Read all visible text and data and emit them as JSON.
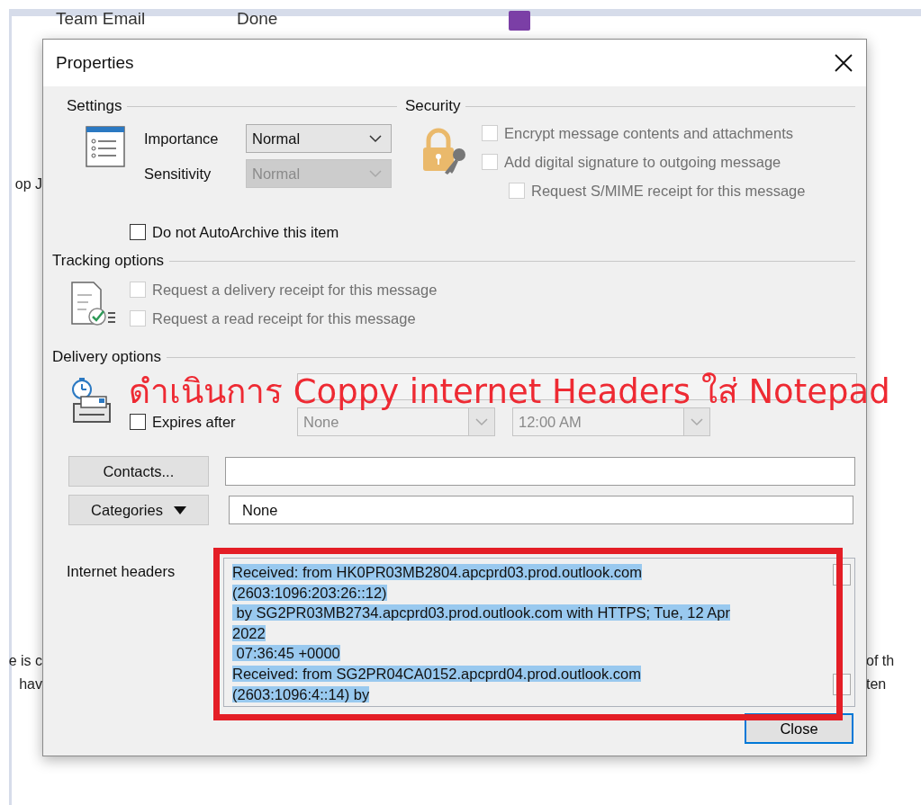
{
  "background": {
    "ribbon_items": [
      {
        "label": "Team Email"
      },
      {
        "label": "Done"
      }
    ],
    "side_fragments": [
      {
        "text": "op J"
      },
      {
        "text": "e is c"
      },
      {
        "text": "hav"
      },
      {
        "text": "of th"
      },
      {
        "text": "ten"
      }
    ]
  },
  "dialog": {
    "title": "Properties",
    "settings": {
      "heading": "Settings",
      "fields": [
        {
          "label": "Importance",
          "value": "Normal",
          "disabled": false
        },
        {
          "label": "Sensitivity",
          "value": "Normal",
          "disabled": true
        }
      ],
      "autoarchive": {
        "label": "Do not AutoArchive this item",
        "checked": false
      }
    },
    "security": {
      "heading": "Security",
      "options": [
        {
          "label": "Encrypt message contents and attachments",
          "checked": false,
          "disabled": true,
          "indented": false
        },
        {
          "label": "Add digital signature to outgoing message",
          "checked": false,
          "disabled": true,
          "indented": false
        },
        {
          "label": "Request S/MIME receipt for this message",
          "checked": false,
          "disabled": true,
          "indented": true
        }
      ]
    },
    "tracking": {
      "heading": "Tracking options",
      "options": [
        {
          "label": "Request a delivery receipt for this message",
          "checked": false,
          "disabled": true
        },
        {
          "label": "Request a read receipt for this message",
          "checked": false,
          "disabled": true
        }
      ]
    },
    "delivery": {
      "heading": "Delivery options",
      "expires": {
        "label": "Expires after",
        "checked": false
      },
      "expires_date": "None",
      "expires_time": "12:00 AM"
    },
    "contacts_button": "Contacts...",
    "categories_button": "Categories",
    "categories_value": "None",
    "headers_label": "Internet headers",
    "header_lines": [
      "Received: from HK0PR03MB2804.apcprd03.prod.outlook.com",
      "(2603:1096:203:26::12)",
      " by SG2PR03MB2734.apcprd03.prod.outlook.com with HTTPS; Tue, 12 Apr",
      "2022",
      " 07:36:45 +0000",
      "Received: from SG2PR04CA0152.apcprd04.prod.outlook.com",
      "(2603:1096:4::14) by"
    ],
    "close_button": "Close"
  },
  "annotation": {
    "text": "ดำเนินการ Coppy internet Headers ใส่ Notepad"
  }
}
